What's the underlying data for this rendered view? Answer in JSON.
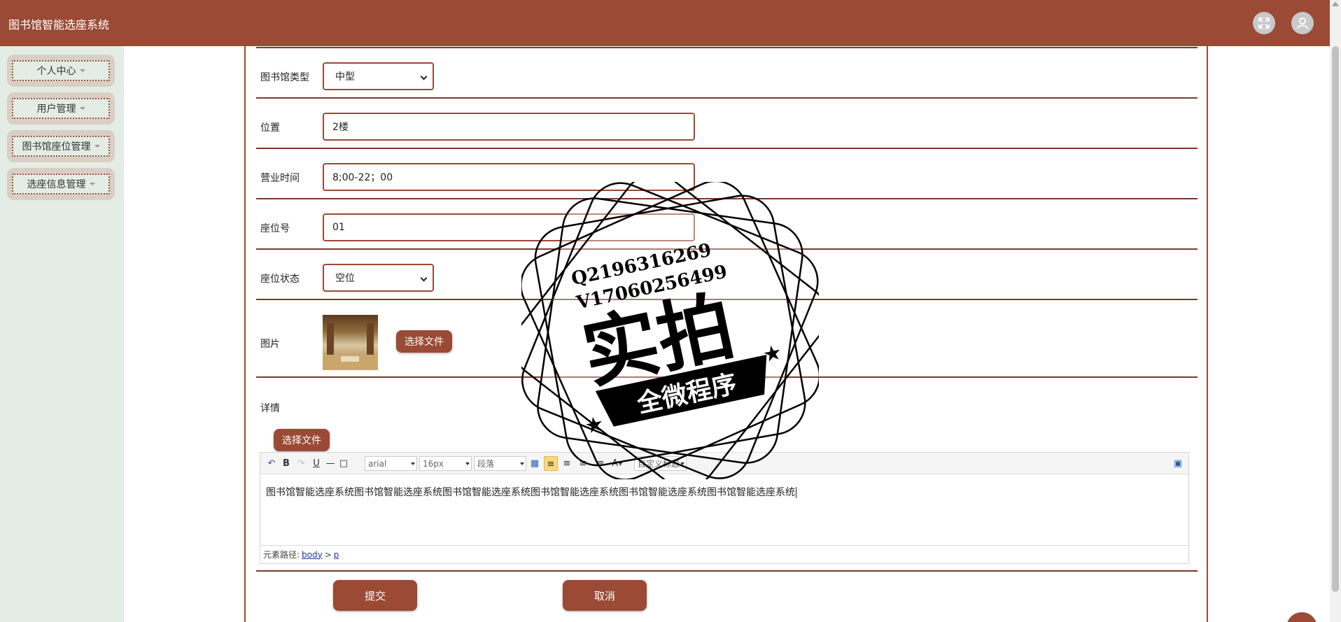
{
  "app": {
    "title": "图书馆智能选座系统"
  },
  "header": {
    "icons": [
      "fullscreen-icon",
      "user-icon"
    ]
  },
  "sidebar": {
    "items": [
      {
        "label": "个人中心"
      },
      {
        "label": "用户管理"
      },
      {
        "label": "图书馆座位管理"
      },
      {
        "label": "选座信息管理"
      }
    ]
  },
  "form": {
    "library_type": {
      "label": "图书馆类型",
      "value": "中型"
    },
    "location": {
      "label": "位置",
      "value": "2楼"
    },
    "hours": {
      "label": "营业时间",
      "value": "8;00-22；00"
    },
    "seat_no": {
      "label": "座位号",
      "value": "01"
    },
    "seat_status": {
      "label": "座位状态",
      "value": "空位"
    },
    "image": {
      "label": "图片",
      "choose_file_label": "选择文件"
    },
    "details": {
      "label": "详情",
      "choose_file_label": "选择文件"
    },
    "submit_label": "提交",
    "cancel_label": "取消"
  },
  "editor": {
    "font_family": "arial",
    "font_size": "16px",
    "paragraph": "段落",
    "custom_heading": "自定义标题",
    "content": "图书馆智能选座系统图书馆智能选座系统图书馆智能选座系统图书馆智能选座系统图书馆智能选座系统图书馆智能选座系统",
    "path_label": "元素路径:",
    "path_body": "body",
    "path_sep": ">",
    "path_p": "p"
  },
  "watermark": {
    "line1": "Q2196316269",
    "line2": "V17060256499",
    "big_text": "实拍",
    "banner_text": "全微程序"
  },
  "colors": {
    "brand": "#9b4a35",
    "sidebar_bg": "#e4ece6",
    "menu_bg": "#d9cfc5"
  }
}
